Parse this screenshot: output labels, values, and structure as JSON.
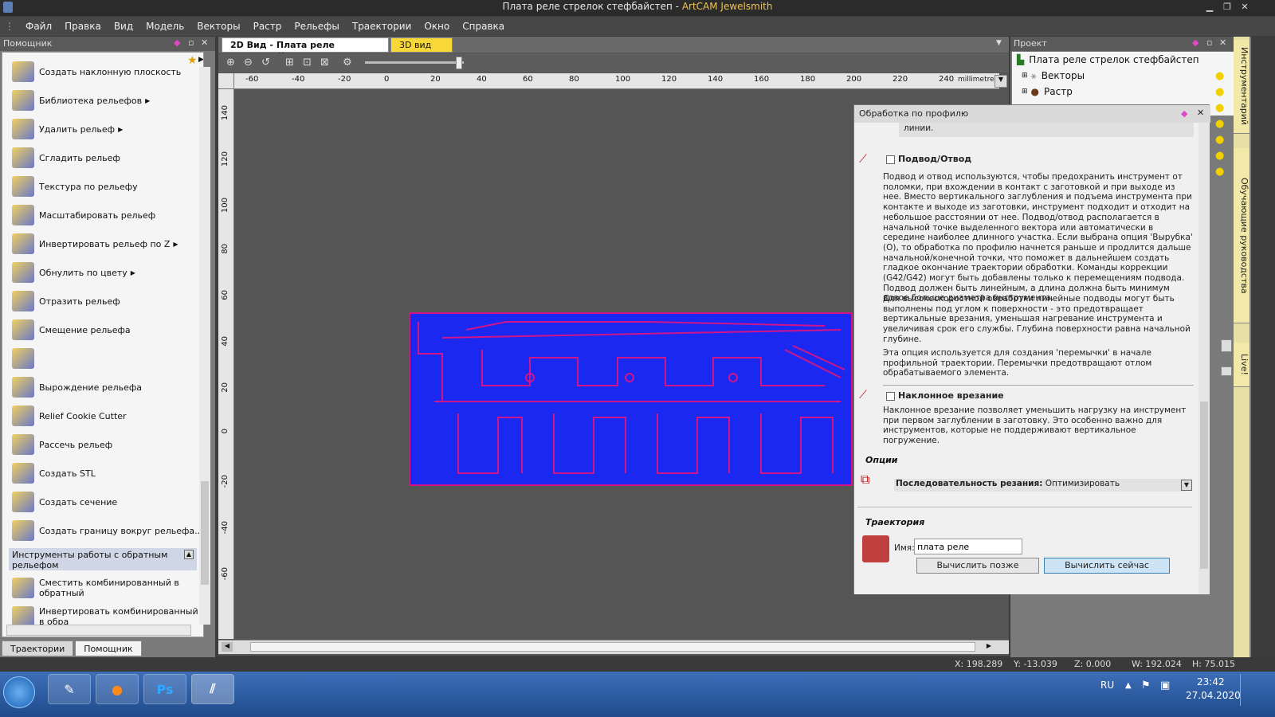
{
  "window": {
    "title": "Плата реле стрелок стефбайстеп",
    "title_suffix": "ArtCAM Jewelsmith",
    "title_separator": " - "
  },
  "menu": [
    "Файл",
    "Правка",
    "Вид",
    "Модель",
    "Векторы",
    "Растр",
    "Рельефы",
    "Траектории",
    "Окно",
    "Справка"
  ],
  "assistant_panel": {
    "title": "Помощник",
    "tools": [
      {
        "label": "Создать наклонную плоскость",
        "icon": "slope-plane-icon"
      },
      {
        "label": "Библиотека рельефов",
        "icon": "relief-library-icon",
        "submenu": true
      },
      {
        "label": "Удалить рельеф",
        "icon": "delete-relief-icon",
        "submenu": true
      },
      {
        "label": "Сгладить рельеф",
        "icon": "smooth-relief-icon"
      },
      {
        "label": "Текстура по рельефу",
        "icon": "texture-relief-icon"
      },
      {
        "label": "Масштабировать рельеф",
        "icon": "scale-relief-icon"
      },
      {
        "label": "Инвертировать рельеф по Z",
        "icon": "invert-z-icon",
        "submenu": true
      },
      {
        "label": "Обнулить по цвету",
        "icon": "zero-color-icon",
        "submenu": true
      },
      {
        "label": "Отразить рельеф",
        "icon": "mirror-relief-icon"
      },
      {
        "label": "Смещение рельефа",
        "icon": "offset-relief-icon"
      },
      {
        "label": "",
        "icon": "relief-profile-icon"
      },
      {
        "label": "Вырождение рельефа",
        "icon": "fade-relief-icon"
      },
      {
        "label": "Relief Cookie Cutter",
        "icon": "cookie-cutter-icon"
      },
      {
        "label": "Рассечь рельеф",
        "icon": "split-relief-icon"
      },
      {
        "label": "Создать STL",
        "icon": "stl-icon"
      },
      {
        "label": "Создать сечение",
        "icon": "section-icon"
      },
      {
        "label": "Создать границу вокруг рельефа...",
        "icon": "border-relief-icon"
      }
    ],
    "group_label": "Инструменты работы с обратным рельефом",
    "group_tools": [
      {
        "label": "Сместить комбинированный в обратный",
        "icon": "offset-combined-icon"
      },
      {
        "label": "Инвертировать комбинированный в обра",
        "icon": "invert-combined-icon"
      }
    ],
    "bottom_tabs": [
      "Траектории",
      "Помощник"
    ]
  },
  "document": {
    "tab_2d": "2D Вид - Плата реле стрелок",
    "tab_3d": "3D вид",
    "ruler_unit": "millimetres",
    "ruler_h": [
      "-60",
      "-40",
      "-20",
      "0",
      "20",
      "40",
      "60",
      "80",
      "100",
      "120",
      "140",
      "160",
      "180",
      "200",
      "220",
      "240"
    ],
    "ruler_v": [
      "140",
      "120",
      "100",
      "80",
      "60",
      "40",
      "20",
      "0",
      "-20",
      "-40",
      "-60"
    ]
  },
  "project_panel": {
    "title": "Проект",
    "root": "Плата реле стрелок стефбайстеп",
    "items": [
      "Векторы",
      "Растр"
    ]
  },
  "profile_dialog": {
    "title": "Обработка по профилю",
    "prev_tail": "линии.",
    "lead": {
      "title": "Подвод/Отвод",
      "text": "Подвод и отвод используются, чтобы предохранить инструмент от поломки, при вхождении в контакт с заготовкой и при выходе из нее. Вместо вертикального заглубления и подъема инструмента при контакте и выходе из заготовки, инструмент подходит и отходит на небольшое расстоянии от нее. Подвод/отвод располагается в начальной точке выделенного вектора или автоматически в середине наиболее длинного участка. Если выбрана опция 'Вырубка' (О), то обработка по профилю начнется раньше и продлится дальше начальной/конечной точки, что поможет в дальнейшем создать гладкое окончание траектории обработки. Команды коррекции (G42/G42) могут быть добавлены только к перемещениям подвода. Подвод должен быть линейным, а длина должна быть минимум вдвое больше диаметра инструмента.",
      "text2": "Для высокоскоростной обработки линейные подводы могут быть выполнены под углом к поверхности - это предотвращает вертикальные врезания, уменьшая нагревание инструмента и увеличивая срок его службы. Глубина поверхности равна начальной глубине.",
      "text3": "Эта опция используется для создания 'перемычки' в начале профильной траектории. Перемычки предотвращают отлом обрабатываемого элемента."
    },
    "ramp": {
      "title": "Наклонное врезание",
      "text": "Наклонное врезание позволяет уменьшить нагрузку на инструмент при первом заглублении в заготовку. Это особенно важно для инструментов, которые не поддерживают вертикальное погружение."
    },
    "options": {
      "title": "Опции",
      "seq_label": "Последовательность резания:",
      "seq_value": "Оптимизировать"
    },
    "toolpath": {
      "title": "Траектория",
      "name_label": "Имя:",
      "name_value": "плата реле",
      "btn_later": "Вычислить позже",
      "btn_now": "Вычислить сейчас"
    }
  },
  "side_tabs": [
    "Инструментарий",
    "Обучающие руководства",
    "Live!"
  ],
  "status": {
    "x": "X: 198.289",
    "y": "Y: -13.039",
    "z": "Z: 0.000",
    "w": "W: 192.024",
    "h": "H: 75.015"
  },
  "taskbar": {
    "lang": "RU",
    "time": "23:42",
    "date": "27.04.2020",
    "apps": [
      "start-icon",
      "notepad-icon",
      "firefox-icon",
      "photoshop-icon",
      "artcam-icon"
    ],
    "ps_label": "Ps"
  },
  "colors": {
    "pcb_fill": "#1b28f0",
    "pcb_trace": "#d0148a",
    "accent": "#f0c050"
  }
}
